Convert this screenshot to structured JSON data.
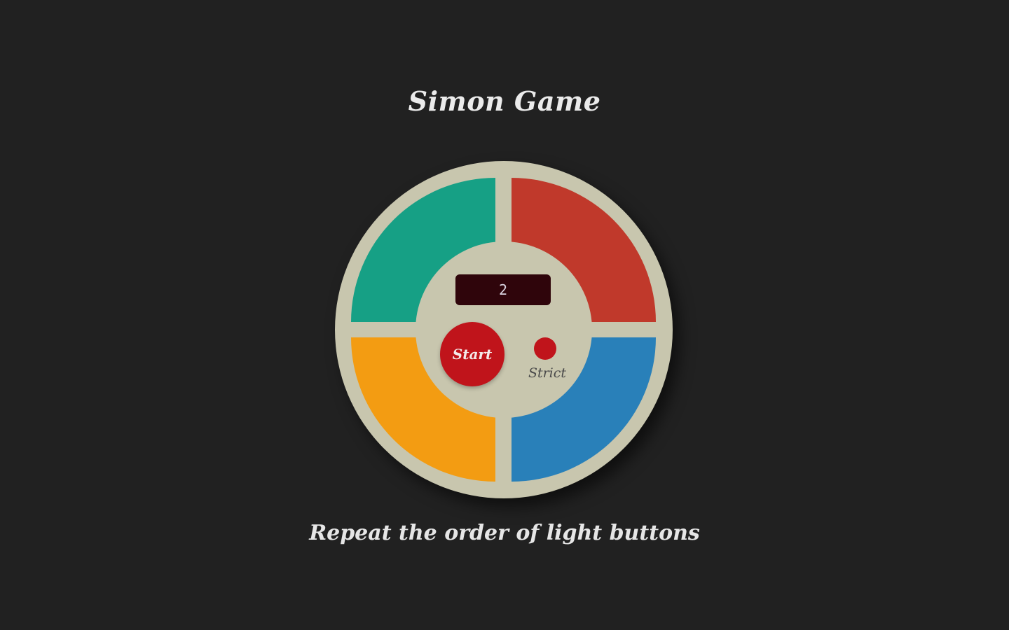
{
  "title": "Simon Game",
  "counter": {
    "value": "2"
  },
  "controls": {
    "start_label": "Start",
    "strict_label": "Strict"
  },
  "instructions": "Repeat the order of light buttons",
  "colors": {
    "background": "#212121",
    "board": "#c8c6ae",
    "green": "#16a085",
    "red": "#c0392b",
    "yellow": "#f39c12",
    "blue": "#2980b9",
    "start_button": "#c0141b",
    "strict_button": "#c0141b",
    "counter_bg": "#2f050b"
  }
}
